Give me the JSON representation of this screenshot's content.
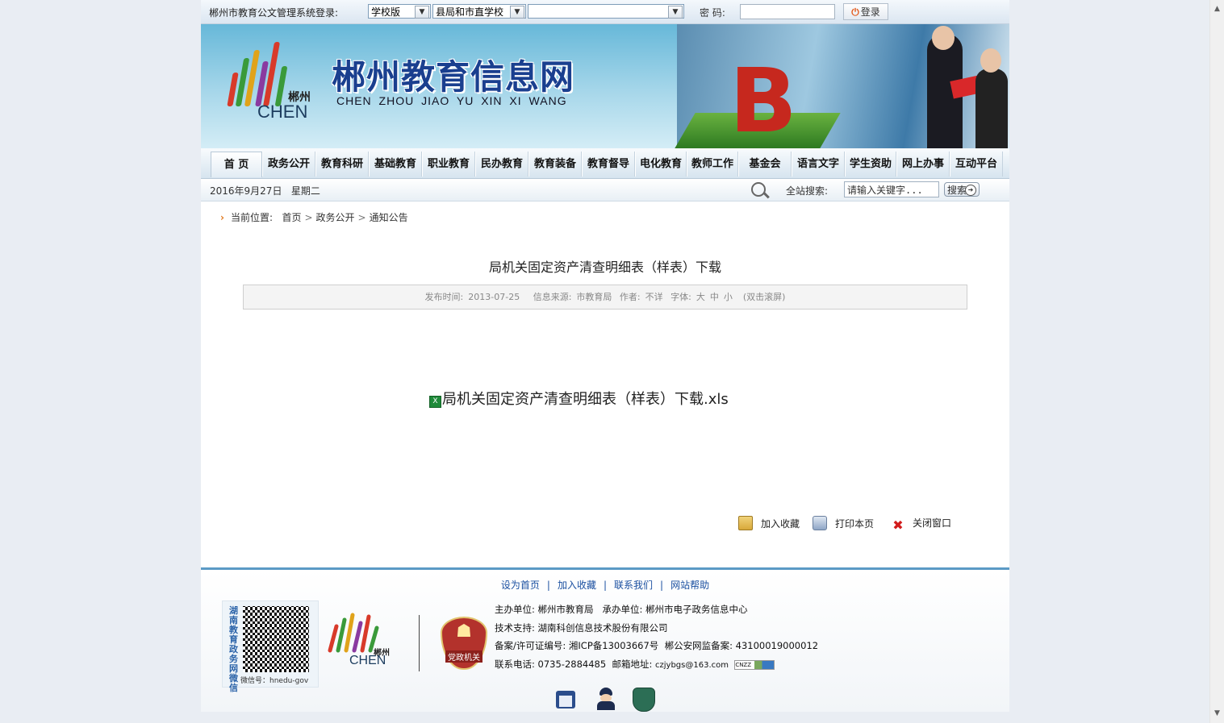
{
  "login": {
    "label": "郴州市教育公文管理系统登录:",
    "version_select": "学校版",
    "unit_select": "县局和市直学校",
    "school_select": "",
    "password_label": "密 码:",
    "password_value": "",
    "login_button": "登录"
  },
  "banner": {
    "title": "郴州教育信息网",
    "subtitle": "CHEN ZHOU JIAO YU XIN XI WANG",
    "logo_cn": "郴州",
    "logo_en": "CHEN"
  },
  "nav": [
    {
      "label": "首 页"
    },
    {
      "label": "政务公开"
    },
    {
      "label": "教育科研"
    },
    {
      "label": "基础教育"
    },
    {
      "label": "职业教育"
    },
    {
      "label": "民办教育"
    },
    {
      "label": "教育装备"
    },
    {
      "label": "教育督导"
    },
    {
      "label": "电化教育"
    },
    {
      "label": "教师工作"
    },
    {
      "label": "基金会"
    },
    {
      "label": "语言文字"
    },
    {
      "label": "学生资助"
    },
    {
      "label": "网上办事"
    },
    {
      "label": "互动平台"
    }
  ],
  "datebar": {
    "date": "2016年9月27日",
    "weekday": "星期二",
    "search_label": "全站搜索:",
    "search_placeholder": "请输入关键字...",
    "search_button": "搜索"
  },
  "breadcrumb": {
    "label": "当前位置:",
    "items": [
      "首页",
      "政务公开",
      "通知公告"
    ]
  },
  "article": {
    "title": "局机关固定资产清查明细表（样表）下载",
    "publish_label": "发布时间:",
    "publish_date": "2013-07-25",
    "source_label": "信息来源:",
    "source": "市教育局",
    "author_label": "作者:",
    "author": "不详",
    "font_label": "字体:",
    "font_large": "大",
    "font_medium": "中",
    "font_small": "小",
    "scroll_hint": "(双击滚屏)",
    "file_link": "局机关固定资产清查明细表（样表）下载.xls"
  },
  "tools": {
    "favorite": "加入收藏",
    "print": "打印本页",
    "close": "关闭窗口"
  },
  "footer": {
    "links": [
      "设为首页",
      "加入收藏",
      "联系我们",
      "网站帮助"
    ],
    "qr_vertical": "湖南教育政务网微信",
    "qr_tag": "微信号：hnedu-gov",
    "logo_cn": "郴州",
    "logo_en": "CHEN",
    "badge_bottom": "党政机关",
    "host": "主办单位: 郴州市教育局",
    "organizer": "承办单位: 郴州市电子政务信息中心",
    "tech": "技术支持: 湖南科创信息技术股份有限公司",
    "icp_label": "备案/许可证编号:",
    "icp": "湘ICP备13003667号",
    "police_label": "郴公安网监备案:",
    "police_no": "43100019000012",
    "phone_label": "联系电话:",
    "phone": "0735-2884485",
    "email_label": "邮箱地址:",
    "email": "czjybgs@163.com",
    "cnzz": "CNZZ"
  },
  "colors": {
    "nav_bg": "#d6e4ef",
    "footer_border": "#5b9ac5",
    "link_blue": "#1a4fa0",
    "accent_orange": "#e0781d"
  }
}
